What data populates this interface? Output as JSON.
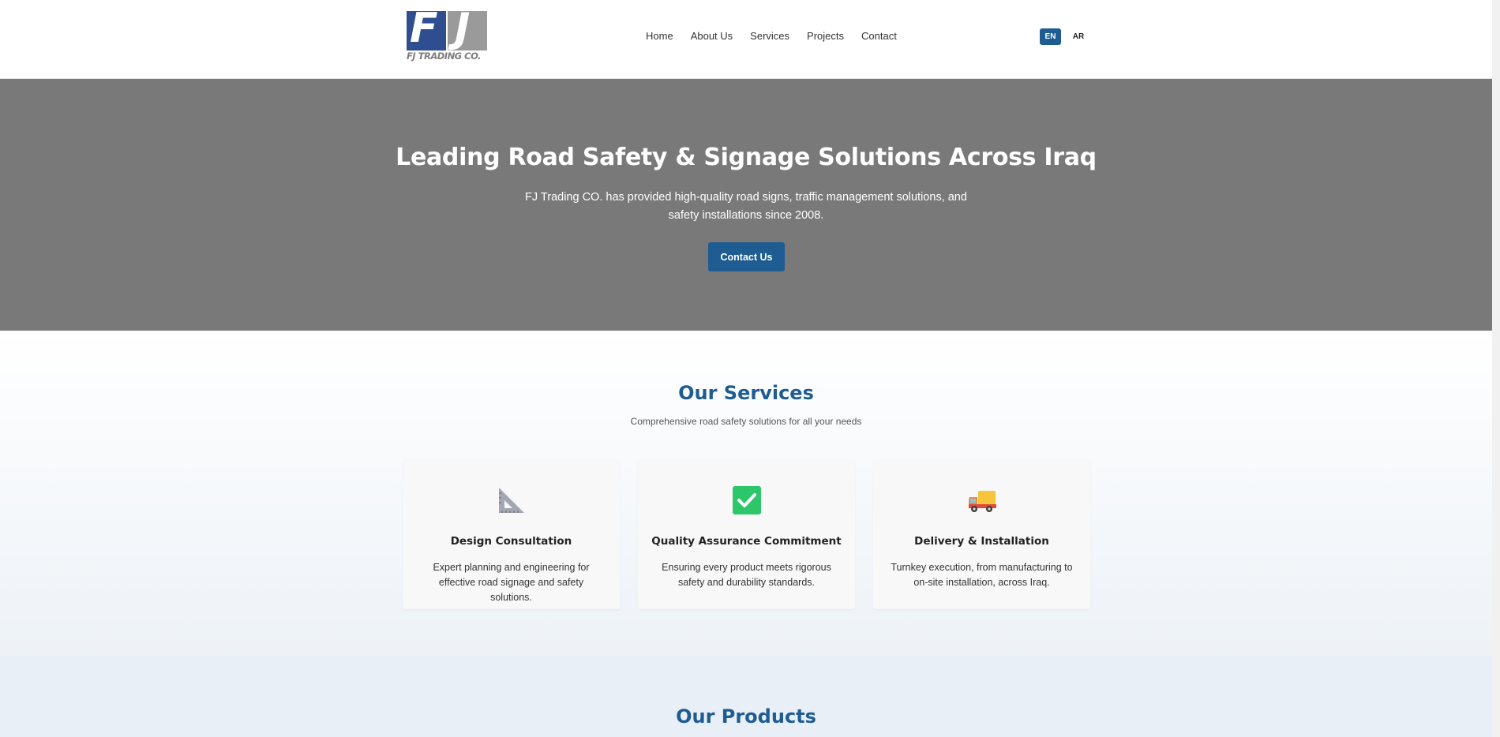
{
  "header": {
    "logo": {
      "letters": "FJ",
      "text": "FJ TRADING CO."
    },
    "nav": [
      {
        "label": "Home"
      },
      {
        "label": "About Us"
      },
      {
        "label": "Services"
      },
      {
        "label": "Projects"
      },
      {
        "label": "Contact"
      }
    ],
    "languages": {
      "active": "EN",
      "other": "AR"
    }
  },
  "hero": {
    "title": "Leading Road Safety & Signage Solutions Across Iraq",
    "subtitle": "FJ Trading CO. has provided high-quality road signs, traffic management solutions, and safety installations since 2008.",
    "button_label": "Contact Us"
  },
  "services": {
    "title": "Our Services",
    "subtitle": "Comprehensive road safety solutions for all your needs",
    "cards": [
      {
        "icon": "triangular-ruler-icon",
        "title": "Design Consultation",
        "text": "Expert planning and engineering for effective road signage and safety solutions."
      },
      {
        "icon": "check-mark-icon",
        "title": "Quality Assurance Commitment",
        "text": "Ensuring every product meets rigorous safety and durability standards."
      },
      {
        "icon": "delivery-truck-icon",
        "title": "Delivery & Installation",
        "text": "Turnkey execution, from manufacturing to on-site installation, across Iraq."
      }
    ]
  },
  "products": {
    "title": "Our Products"
  },
  "colors": {
    "brand_blue": "#1e5c92",
    "hero_bg": "#797979",
    "logo_blue": "#2f4e8f",
    "logo_gray": "#9a9a9a",
    "check_green": "#2ec66b"
  }
}
